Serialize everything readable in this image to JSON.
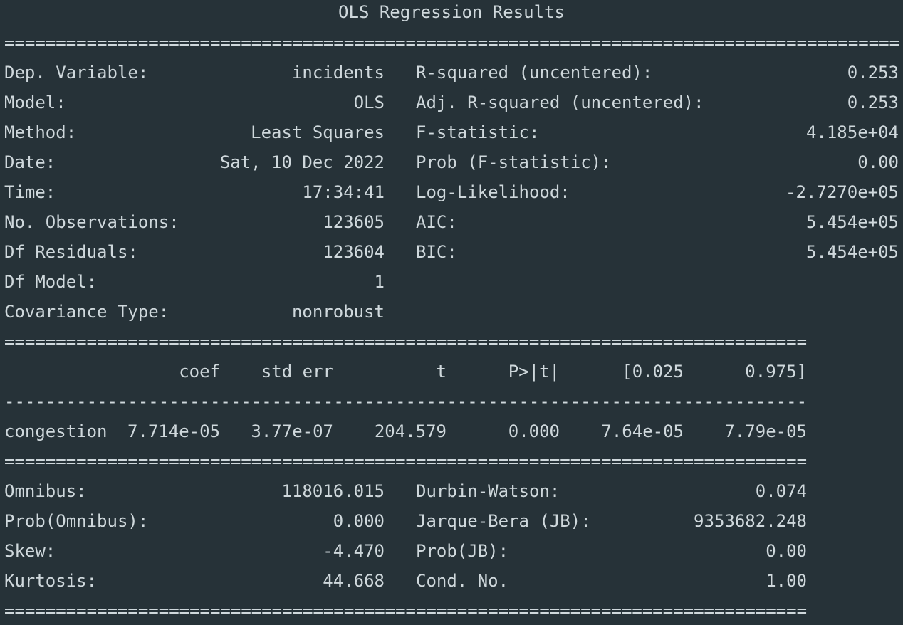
{
  "title": "OLS Regression Results",
  "rule_double": "=",
  "rule_single": "-",
  "top_left": [
    {
      "label": "Dep. Variable:",
      "value": "incidents"
    },
    {
      "label": "Model:",
      "value": "OLS"
    },
    {
      "label": "Method:",
      "value": "Least Squares"
    },
    {
      "label": "Date:",
      "value": "Sat, 10 Dec 2022"
    },
    {
      "label": "Time:",
      "value": "17:34:41"
    },
    {
      "label": "No. Observations:",
      "value": "123605"
    },
    {
      "label": "Df Residuals:",
      "value": "123604"
    },
    {
      "label": "Df Model:",
      "value": "1"
    },
    {
      "label": "Covariance Type:",
      "value": "nonrobust"
    }
  ],
  "top_right": [
    {
      "label": "R-squared (uncentered):",
      "value": "0.253"
    },
    {
      "label": "Adj. R-squared (uncentered):",
      "value": "0.253"
    },
    {
      "label": "F-statistic:",
      "value": "4.185e+04"
    },
    {
      "label": "Prob (F-statistic):",
      "value": "0.00"
    },
    {
      "label": "Log-Likelihood:",
      "value": "-2.7270e+05"
    },
    {
      "label": "AIC:",
      "value": "5.454e+05"
    },
    {
      "label": "BIC:",
      "value": "5.454e+05"
    }
  ],
  "coef_headers": [
    "coef",
    "std err",
    "t",
    "P>|t|",
    "[0.025",
    "0.975]"
  ],
  "coef_rows": [
    {
      "name": "congestion",
      "values": [
        "7.714e-05",
        "3.77e-07",
        "204.579",
        "0.000",
        "7.64e-05",
        "7.79e-05"
      ]
    }
  ],
  "bottom_left": [
    {
      "label": "Omnibus:",
      "value": "118016.015"
    },
    {
      "label": "Prob(Omnibus):",
      "value": "0.000"
    },
    {
      "label": "Skew:",
      "value": "-4.470"
    },
    {
      "label": "Kurtosis:",
      "value": "44.668"
    }
  ],
  "bottom_right": [
    {
      "label": "Durbin-Watson:",
      "value": "0.074"
    },
    {
      "label": "Jarque-Bera (JB):",
      "value": "9353682.248"
    },
    {
      "label": "Prob(JB):",
      "value": "0.00"
    },
    {
      "label": "Cond. No.",
      "value": "1.00"
    }
  ]
}
